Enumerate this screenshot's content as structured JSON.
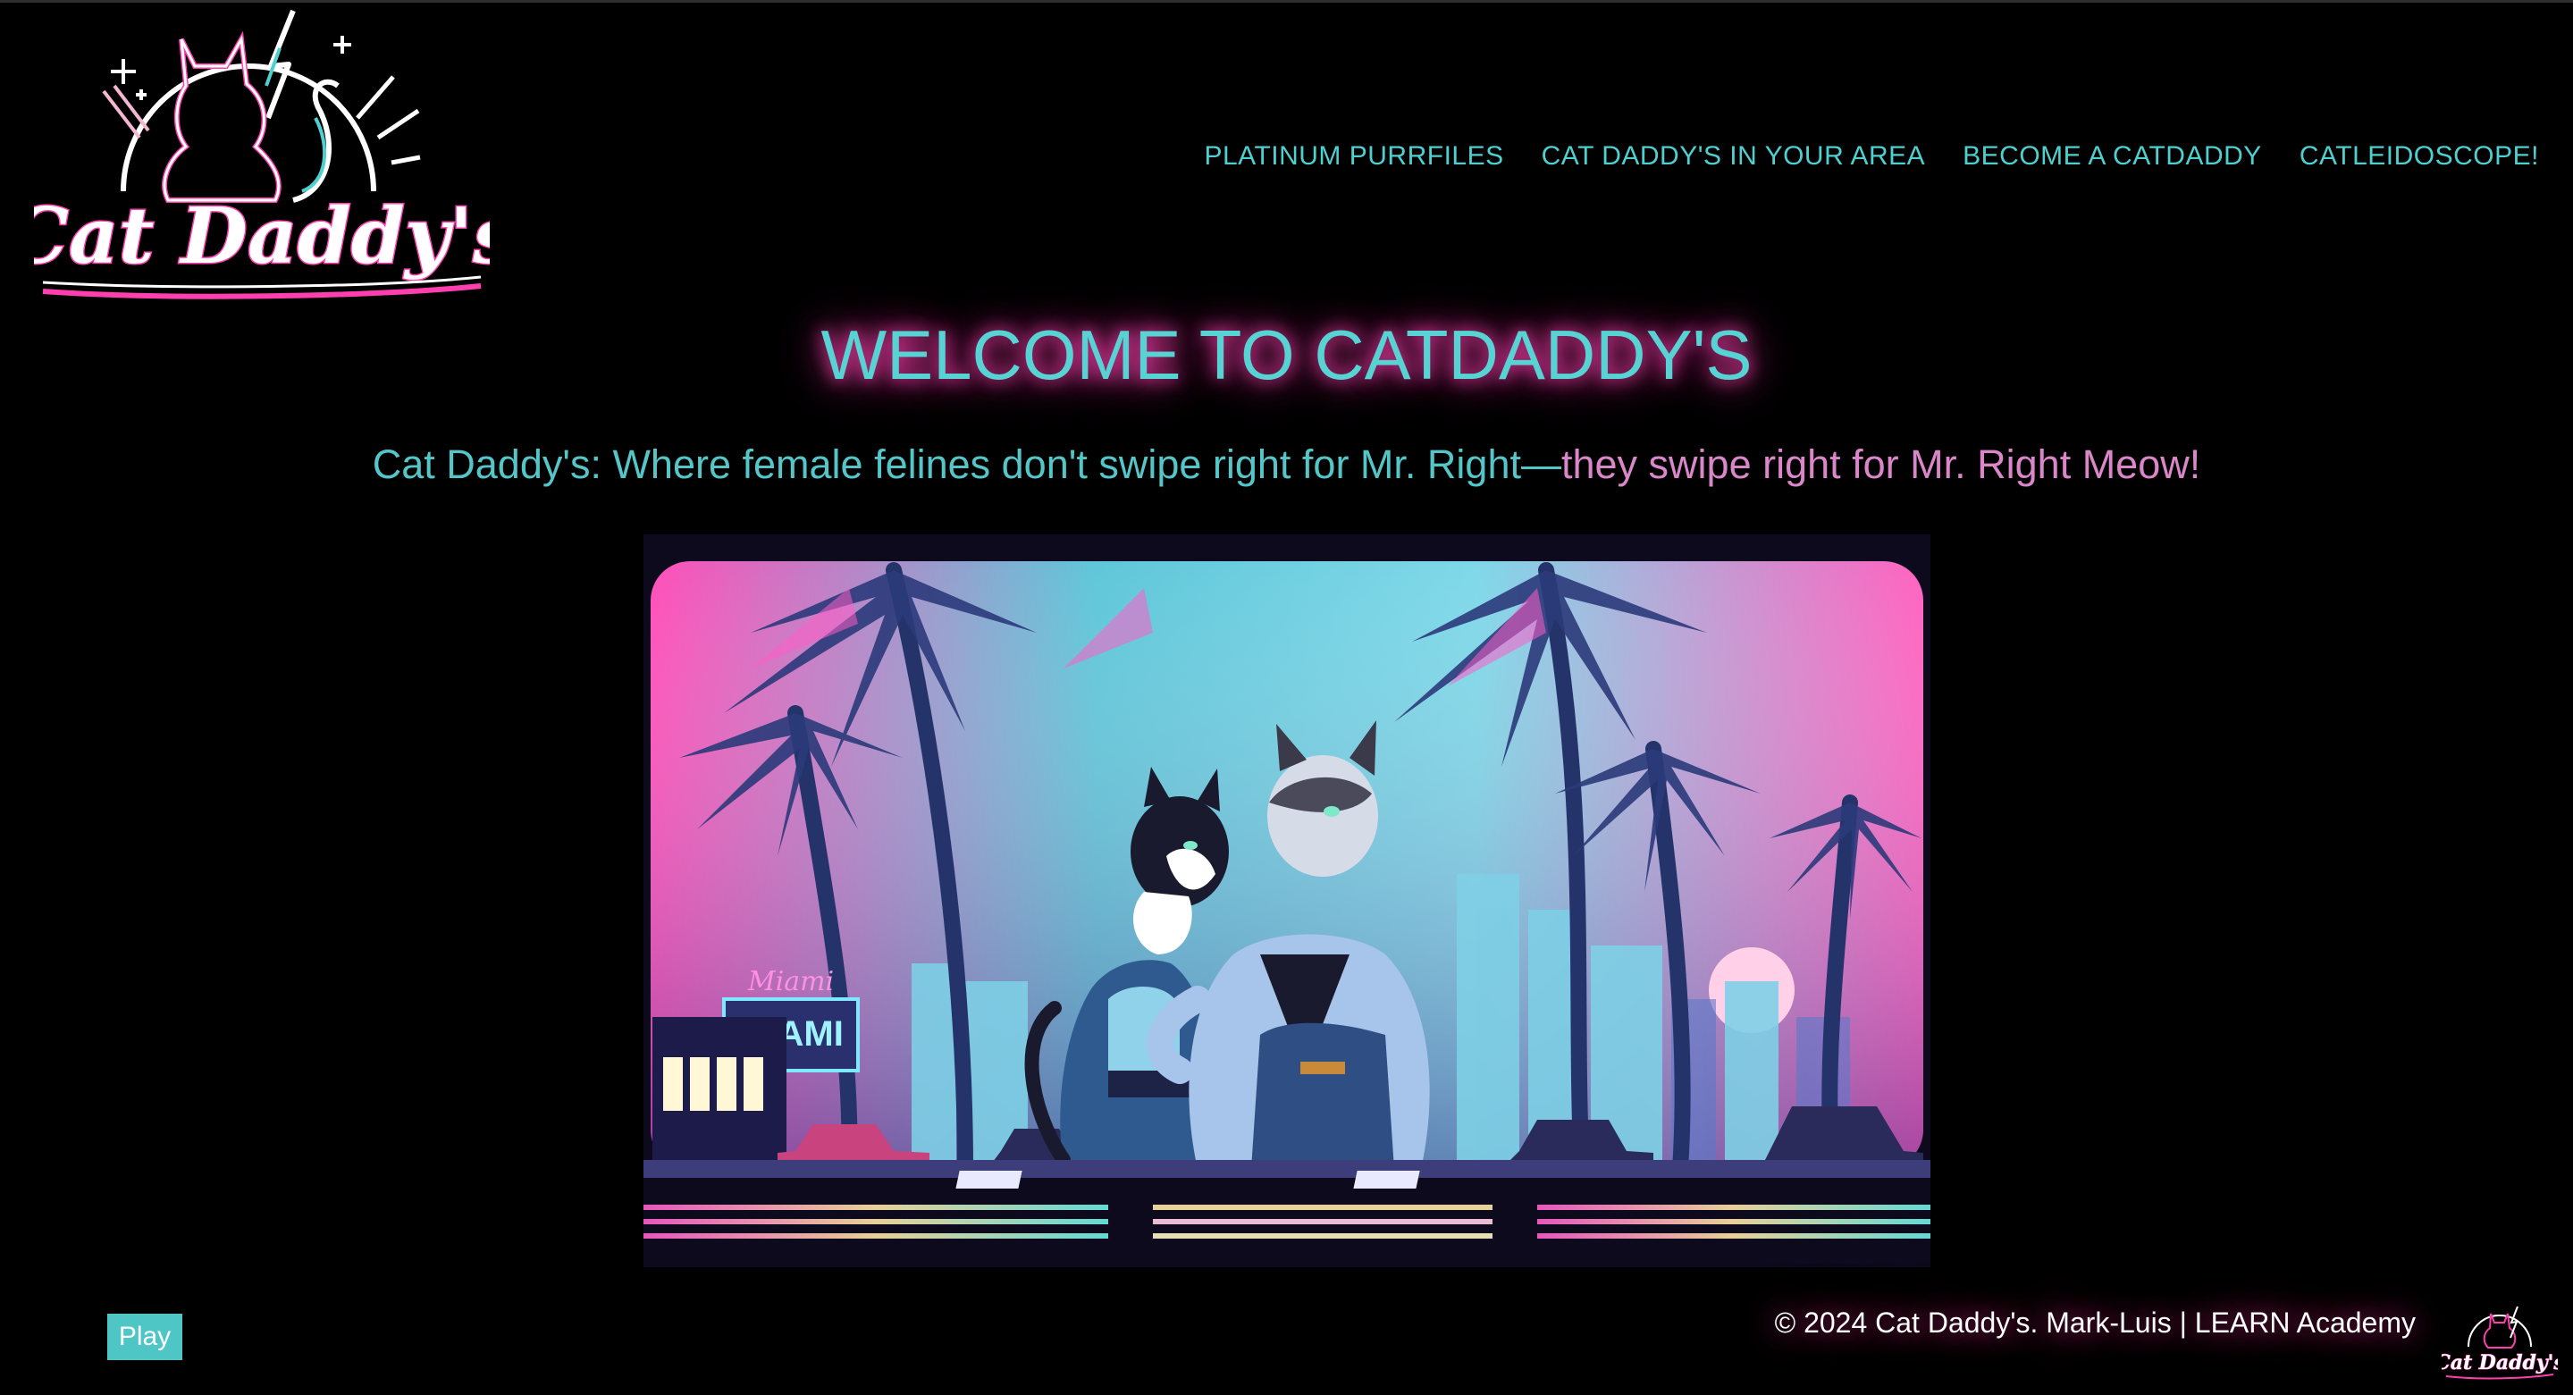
{
  "brand": {
    "logo_text": "Cat Daddy's",
    "accent_teal": "#4dd0cf",
    "accent_pink": "#ff3fb0"
  },
  "nav": {
    "items": [
      {
        "label": "PLATINUM PURRFILES"
      },
      {
        "label": "CAT DADDY'S IN YOUR AREA"
      },
      {
        "label": "BECOME A CATDADDY"
      },
      {
        "label": "CATLEIDOSCOPE!"
      }
    ]
  },
  "main": {
    "heading": "WELCOME TO CATDADDY'S",
    "tagline_part_a": "Cat Daddy's: Where female felines don't swipe right for Mr. Right—",
    "tagline_part_b": "they swipe right for Mr. Right Meow!",
    "hero_sign_script": "Miami",
    "hero_sign_text": "MIAMI"
  },
  "footer": {
    "play_label": "Play",
    "copyright": "© 2024 Cat Daddy's. Mark-Luis | LEARN Academy",
    "logo_text": "Cat Daddy's"
  }
}
